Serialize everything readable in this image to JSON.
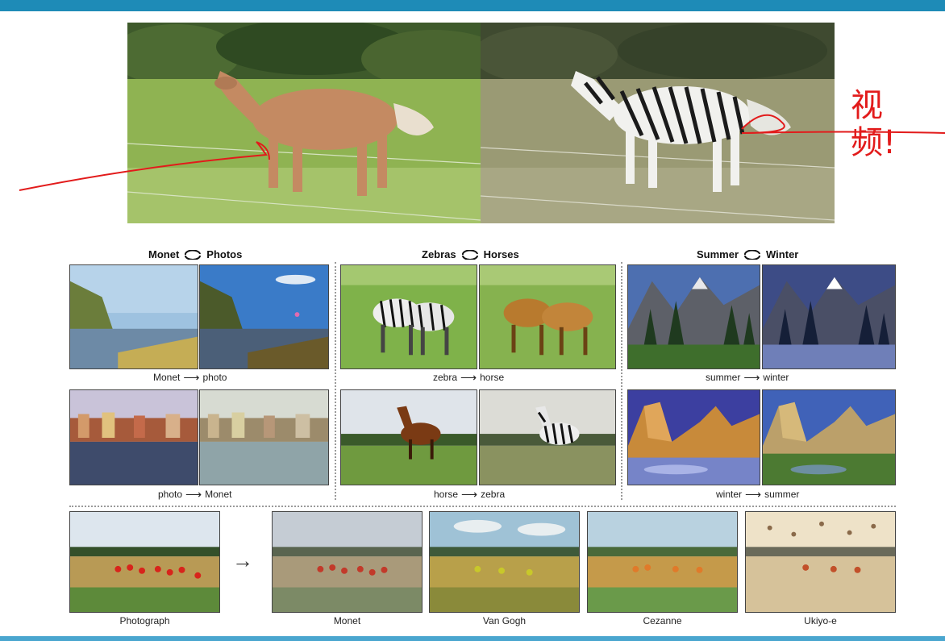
{
  "groups": [
    {
      "left_label": "Monet",
      "right_label": "Photos",
      "row1_caption_a": "Monet",
      "row1_caption_b": "photo",
      "row2_caption_a": "photo",
      "row2_caption_b": "Monet"
    },
    {
      "left_label": "Zebras",
      "right_label": "Horses",
      "row1_caption_a": "zebra",
      "row1_caption_b": "horse",
      "row2_caption_a": "horse",
      "row2_caption_b": "zebra"
    },
    {
      "left_label": "Summer",
      "right_label": "Winter",
      "row1_caption_a": "summer",
      "row1_caption_b": "winter",
      "row2_caption_a": "winter",
      "row2_caption_b": "summer"
    }
  ],
  "style_row": {
    "source_label": "Photograph",
    "styles": [
      "Monet",
      "Van Gogh",
      "Cezanne",
      "Ukiyo-e"
    ],
    "arrow": "→"
  },
  "annotation": {
    "line1": "视",
    "line2": "频!",
    "color": "#e21b1b"
  },
  "colors": {
    "topbar": "#1e8bb7",
    "bottombar": "#4aa6cf"
  }
}
